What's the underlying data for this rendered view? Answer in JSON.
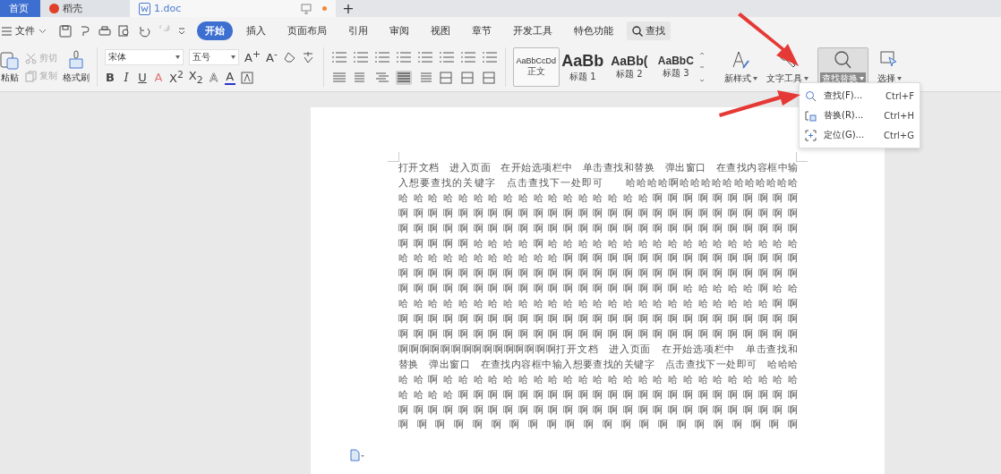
{
  "tabs": [
    {
      "label": "首页",
      "kind": "home",
      "selected": false
    },
    {
      "label": "稻壳",
      "kind": "docer",
      "selected": false
    },
    {
      "label": "1.doc",
      "kind": "doc",
      "selected": true
    }
  ],
  "new_tab": "+",
  "menu": {
    "file": "文件",
    "search": "查找",
    "ribbon_tabs": [
      {
        "label": "开始",
        "selected": true
      },
      {
        "label": "插入",
        "selected": false
      },
      {
        "label": "页面布局",
        "selected": false
      },
      {
        "label": "引用",
        "selected": false
      },
      {
        "label": "审阅",
        "selected": false
      },
      {
        "label": "视图",
        "selected": false
      },
      {
        "label": "章节",
        "selected": false
      },
      {
        "label": "开发工具",
        "selected": false
      },
      {
        "label": "特色功能",
        "selected": false
      }
    ]
  },
  "clipboard": {
    "paste": "粘贴",
    "cut": {
      "label": "剪切",
      "disabled": true
    },
    "copy": {
      "label": "复制",
      "disabled": true
    },
    "painter": "格式刷"
  },
  "font": {
    "name": "宋体",
    "size": "五号",
    "size_buttons": [
      "A$^{+}$",
      "A$^{-}$"
    ],
    "format_buttons": [
      "B",
      "I",
      "U",
      "A",
      "X$^{2}$",
      "X$_{2}$",
      "A",
      "A"
    ]
  },
  "alignments": [
    {
      "selected": false
    },
    {
      "selected": false
    },
    {
      "selected": false
    },
    {
      "selected": true
    },
    {
      "selected": false
    }
  ],
  "styles": [
    {
      "preview": "AaBbCcDd",
      "label": "正文",
      "selected": true,
      "kind": "normal"
    },
    {
      "preview": "AaBb",
      "label": "标题 1",
      "selected": false,
      "kind": "h1"
    },
    {
      "preview": "AaBb(",
      "label": "标题 2",
      "selected": false,
      "kind": "h2"
    },
    {
      "preview": "AaBbC",
      "label": "标题 3",
      "selected": false,
      "kind": "h3"
    }
  ],
  "new_style": "新样式",
  "text_tools": "文字工具",
  "find_replace": {
    "label": "查找替换",
    "selected": true
  },
  "select": "选择",
  "dropdown": [
    {
      "label": "查找(F)...",
      "shortcut": "Ctrl+F",
      "kind": "find"
    },
    {
      "label": "替换(R)...",
      "shortcut": "Ctrl+H",
      "kind": "replace"
    },
    {
      "label": "定位(G)...",
      "shortcut": "Ctrl+G",
      "kind": "goto"
    }
  ],
  "document": {
    "lines": [
      "打开文档　进入页面　在开始选项栏中　单击查找和替换　弹出窗口　在查找内容框中输",
      "入想要查找的关键字　点击查找下一处即可　　哈哈哈哈啊哈哈哈哈哈哈哈哈哈哈哈",
      "哈哈哈哈哈哈哈哈哈哈哈哈哈哈哈哈哈啊啊啊啊啊啊啊啊啊啊",
      "啊啊啊啊啊啊啊啊啊啊啊啊啊啊啊啊啊啊啊啊啊啊啊啊啊啊啊",
      "啊啊啊啊啊啊啊啊啊啊啊啊啊啊啊啊啊啊啊啊啊啊啊啊啊啊啊",
      "啊啊啊啊啊哈哈哈哈啊哈哈哈哈哈哈哈哈哈哈哈哈哈哈哈哈哈",
      "哈哈哈哈哈哈哈哈哈哈哈啊啊啊啊啊啊啊啊啊啊啊啊啊啊啊啊",
      "啊啊啊啊啊啊啊啊啊啊啊啊啊啊啊啊啊啊啊啊啊啊啊啊啊啊啊",
      "啊啊啊啊啊啊啊啊啊啊啊啊啊啊啊啊啊啊啊哈哈哈哈哈啊哈哈",
      "哈哈哈哈哈哈哈哈哈哈哈哈哈哈哈哈哈哈哈哈哈哈哈哈哈啊啊",
      "啊啊啊啊啊啊啊啊啊啊啊啊啊啊啊啊啊啊啊啊啊啊啊啊啊啊啊",
      "啊啊啊啊啊啊啊啊啊啊啊啊啊啊啊啊啊啊啊啊啊啊啊啊啊啊啊",
      "啊啊啊啊啊啊啊啊啊啊啊啊啊啊啊打开文档　进入页面　在开始选项栏中　单击查找和",
      "替换　弹出窗口　在查找内容框中输入想要查找的关键字　点击查找下一处即可　哈哈哈",
      "哈哈啊哈哈哈哈哈哈哈哈哈哈哈哈哈哈哈哈哈哈哈哈哈哈哈哈",
      "哈哈哈哈啊啊啊啊啊啊啊啊啊啊啊啊啊啊啊啊啊啊啊啊啊啊啊",
      "啊啊啊啊啊啊啊啊啊啊啊啊啊啊啊啊啊啊啊啊啊啊啊啊啊啊啊",
      "啊啊啊啊啊啊啊啊啊啊啊啊啊啊啊啊啊啊啊啊啊啊"
    ]
  }
}
